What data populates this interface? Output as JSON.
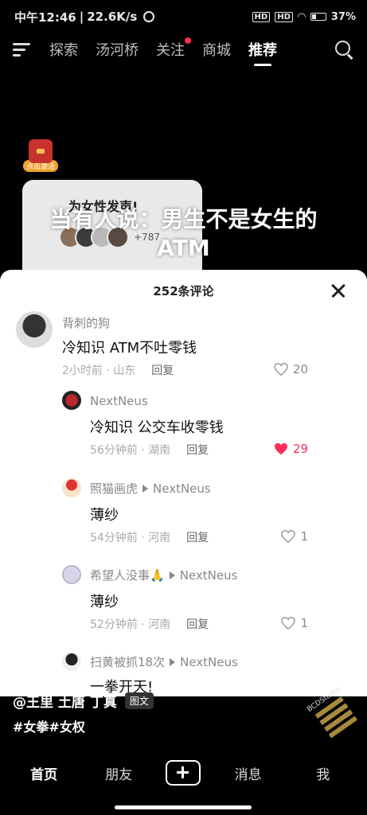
{
  "status_bar": {
    "time": "中午12:46",
    "speed": "22.6K/s",
    "battery": "37%"
  },
  "top_nav": {
    "tabs": [
      "探索",
      "汤河桥",
      "关注",
      "商城",
      "推荐"
    ],
    "active_tab": "推荐",
    "notification_dot_on": "关注"
  },
  "red_packet": {
    "label": "点击激活"
  },
  "card": {
    "title": "为女性发声!",
    "supporter_count": "+787"
  },
  "video_title": "当有人说：男生不是女生的ATM",
  "comments_sheet": {
    "header": "252条评论",
    "comments": [
      {
        "user": "背刺的狗",
        "text": "冷知识 ATM不吐零钱",
        "time_location": "2小时前 · 山东",
        "reply_label": "回复",
        "likes": "20",
        "liked": false
      },
      {
        "user": "NextNeus",
        "text": "冷知识 公交车收零钱",
        "time_location": "56分钟前 · 湖南",
        "reply_label": "回复",
        "likes": "29",
        "liked": true
      },
      {
        "user": "照猫画虎",
        "reply_to": "NextNeus",
        "text": "薄纱",
        "time_location": "54分钟前 · 河南",
        "reply_label": "回复",
        "likes": "1",
        "liked": false
      },
      {
        "user": "希望人没事🙏",
        "reply_to": "NextNeus",
        "text": "薄纱",
        "time_location": "52分钟前 · 河南",
        "reply_label": "回复",
        "likes": "1",
        "liked": false
      },
      {
        "user": "扫黄被抓18次",
        "reply_to": "NextNeus",
        "text": "一拳开天!"
      }
    ]
  },
  "author_line": {
    "author": "@王里 土唐 丁真",
    "type_tag": "图文"
  },
  "hashtags": "#女拳#女权",
  "watermark": "BCDStudio",
  "bottom_nav": {
    "items": [
      "首页",
      "朋友",
      "消息",
      "我"
    ],
    "active": "首页"
  },
  "colors": {
    "like_red": "#ff2d55",
    "accent_dot": "#ff2d55"
  }
}
